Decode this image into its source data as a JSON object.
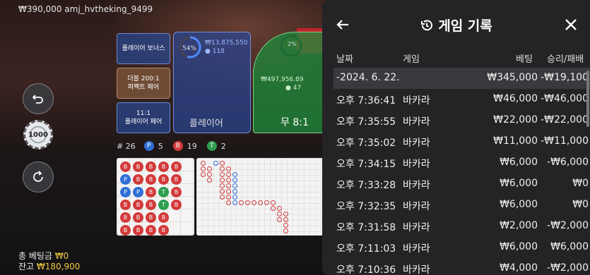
{
  "top": {
    "balance_user": "₩390,000 amj_hvtheking_9499"
  },
  "chip": {
    "value": "1000"
  },
  "bets": {
    "player_bonus": "플레이어 보너스",
    "perfect_pair_odds": "더블 200:1",
    "perfect_pair": "퍼펙트 페어",
    "player_pair_odds": "11:1",
    "player_pair": "플레이어 페어",
    "player_pct": "54%",
    "player_total": "₩13,875,550",
    "player_count": "118",
    "player_label": "플레이어",
    "tie_pct": "2%",
    "tie_total": "₩497,956.89",
    "tie_count": "47",
    "tie_label": "무 8:1"
  },
  "counts": {
    "rounds_label": "#",
    "rounds": "26",
    "p_label": "P",
    "p": "5",
    "b_label": "B",
    "b": "19",
    "t_label": "T",
    "t": "2"
  },
  "totals": {
    "bet_label": "총 베팅금",
    "bet_value": "₩0",
    "balance_label": "잔고",
    "balance_value": "₩180,900"
  },
  "panel": {
    "title": "게임 기록",
    "headers": {
      "date": "날짜",
      "game": "게임",
      "bet": "베팅",
      "winloss": "승리/패배"
    },
    "rows": [
      {
        "date": "-2024. 6. 22.",
        "game": "",
        "bet": "₩345,000",
        "winloss": "-₩19,100"
      },
      {
        "date": "오후 7:36:41",
        "game": "바카라",
        "bet": "₩46,000",
        "winloss": "-₩46,000"
      },
      {
        "date": "오후 7:35:55",
        "game": "바카라",
        "bet": "₩22,000",
        "winloss": "-₩22,000"
      },
      {
        "date": "오후 7:35:02",
        "game": "바카라",
        "bet": "₩11,000",
        "winloss": "-₩11,000"
      },
      {
        "date": "오후 7:34:15",
        "game": "바카라",
        "bet": "₩6,000",
        "winloss": "-₩6,000"
      },
      {
        "date": "오후 7:33:28",
        "game": "바카라",
        "bet": "₩6,000",
        "winloss": "₩0"
      },
      {
        "date": "오후 7:32:35",
        "game": "바카라",
        "bet": "₩6,000",
        "winloss": "₩0"
      },
      {
        "date": "오후 7:31:58",
        "game": "바카라",
        "bet": "₩2,000",
        "winloss": "-₩2,000"
      },
      {
        "date": "오후 7:11:03",
        "game": "바카라",
        "bet": "₩6,000",
        "winloss": "₩6,000"
      },
      {
        "date": "오후 7:10:36",
        "game": "바카라",
        "bet": "₩4,000",
        "winloss": "-₩2,000"
      }
    ]
  },
  "colors": {
    "player": "#2f6fd6",
    "banker": "#d33a3a",
    "tie": "#2e9e4f",
    "accent": "#f2c843"
  }
}
